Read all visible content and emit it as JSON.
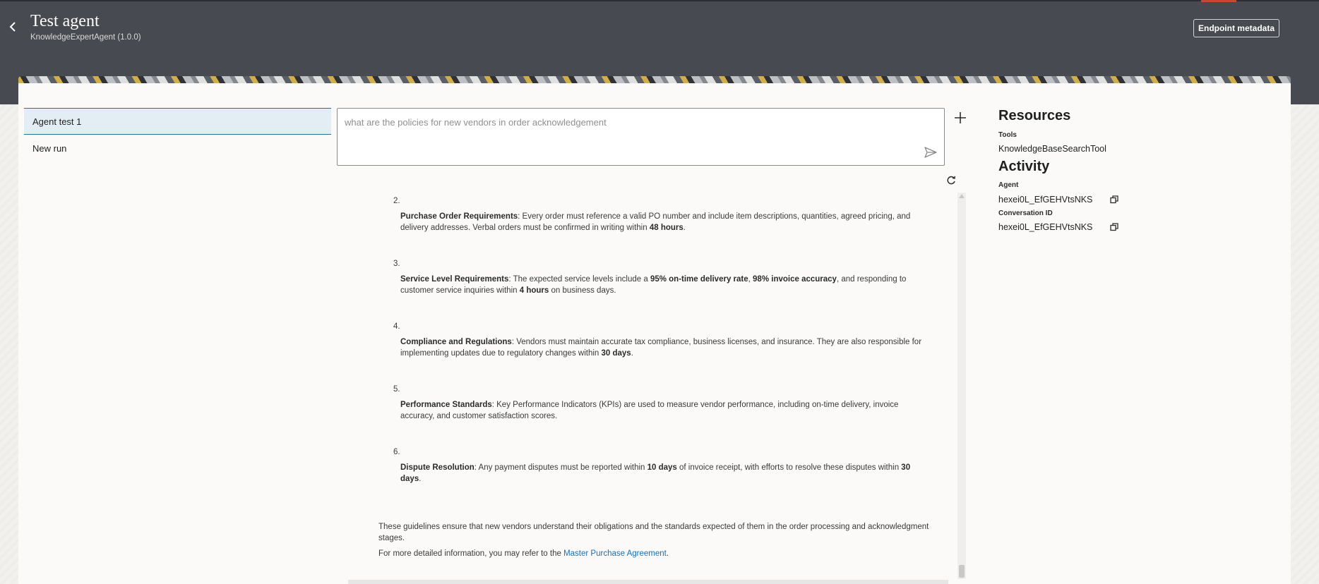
{
  "header": {
    "title": "Test agent",
    "subtitle": "KnowledgeExpertAgent (1.0.0)",
    "endpoint_button": "Endpoint metadata"
  },
  "runs": {
    "items": [
      {
        "label": "Agent test 1",
        "selected": true
      },
      {
        "label": "New run",
        "selected": false
      }
    ]
  },
  "prompt": {
    "placeholder": "what are the policies for new vendors in order acknowledgement"
  },
  "response": {
    "items": [
      {
        "number": "2.",
        "title": "Purchase Order Requirements",
        "t1": ": Every order must reference a valid PO number and include item descriptions, quantities, agreed pricing, and delivery addresses. Verbal orders must be confirmed in writing within ",
        "b1": "48 hours",
        "t2": "."
      },
      {
        "number": "3.",
        "title": "Service Level Requirements",
        "t1": ": The expected service levels include a ",
        "b1": "95% on-time delivery rate",
        "t2": ", ",
        "b2": "98% invoice accuracy",
        "t3": ", and responding to customer service inquiries within ",
        "b3": "4 hours",
        "t4": " on business days."
      },
      {
        "number": "4.",
        "title": "Compliance and Regulations",
        "t1": ": Vendors must maintain accurate tax compliance, business licenses, and insurance. They are also responsible for implementing updates due to regulatory changes within ",
        "b1": "30 days",
        "t2": "."
      },
      {
        "number": "5.",
        "title": "Performance Standards",
        "t1": ": Key Performance Indicators (KPIs) are used to measure vendor performance, including on-time delivery, invoice accuracy, and customer satisfaction scores."
      },
      {
        "number": "6.",
        "title": "Dispute Resolution",
        "t1": ": Any payment disputes must be reported within ",
        "b1": "10 days",
        "t2": " of invoice receipt, with efforts to resolve these disputes within ",
        "b2": "30 days",
        "t3": "."
      }
    ],
    "summary": "These guidelines ensure that new vendors understand their obligations and the standards expected of them in the order processing and acknowledgment stages.",
    "more_prefix": "For more detailed information, you may refer to the ",
    "more_link": "Master Purchase Agreement",
    "more_suffix": "."
  },
  "side": {
    "resources_title": "Resources",
    "tools_label": "Tools",
    "tool_name": "KnowledgeBaseSearchTool",
    "activity_title": "Activity",
    "agent_label": "Agent",
    "agent_id": "hexei0L_EfGEHVtsNKS",
    "conversation_label": "Conversation ID",
    "conversation_id": "hexei0L_EfGEHVtsNKS"
  },
  "colors": {
    "header_bg": "#474a50",
    "accent_red": "#c74634",
    "selected_row": "#e3eef4",
    "link": "#1b6eb0"
  }
}
